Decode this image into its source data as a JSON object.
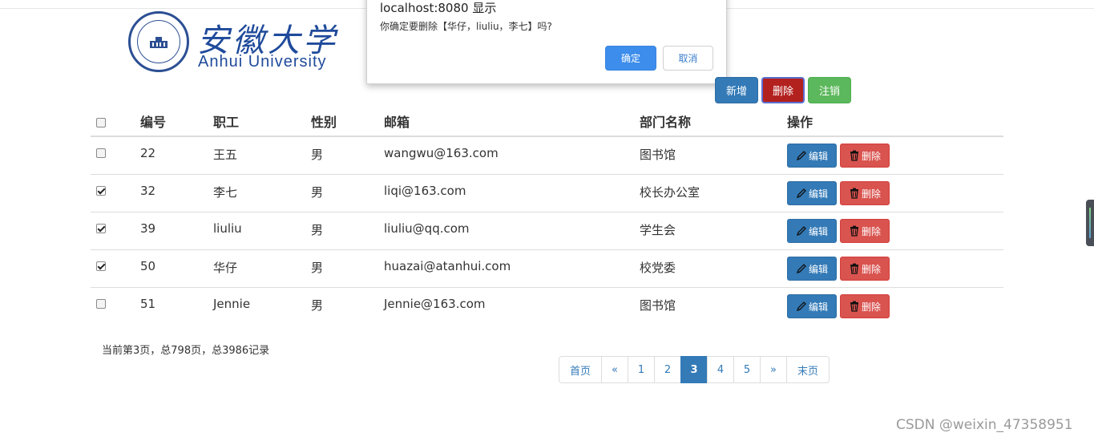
{
  "logo": {
    "cn": "安徽大学",
    "en": "Anhui University"
  },
  "dialog": {
    "title": "localhost:8080 显示",
    "message": "你确定要删除【华仔，liuliu，李七】吗?",
    "ok": "确定",
    "cancel": "取消"
  },
  "toolbar": {
    "add": "新增",
    "delete": "删除",
    "logout": "注销"
  },
  "table": {
    "headers": {
      "id": "编号",
      "name": "职工",
      "gender": "性别",
      "email": "邮箱",
      "dept": "部门名称",
      "op": "操作"
    },
    "edit_label": "编辑",
    "delete_label": "删除",
    "rows": [
      {
        "checked": false,
        "id": "22",
        "name": "王五",
        "gender": "男",
        "email": "wangwu@163.com",
        "dept": "图书馆"
      },
      {
        "checked": true,
        "id": "32",
        "name": "李七",
        "gender": "男",
        "email": "liqi@163.com",
        "dept": "校长办公室"
      },
      {
        "checked": true,
        "id": "39",
        "name": "liuliu",
        "gender": "男",
        "email": "liuliu@qq.com",
        "dept": "学生会"
      },
      {
        "checked": true,
        "id": "50",
        "name": "华仔",
        "gender": "男",
        "email": "huazai@atanhui.com",
        "dept": "校党委"
      },
      {
        "checked": false,
        "id": "51",
        "name": "Jennie",
        "gender": "男",
        "email": "Jennie@163.com",
        "dept": "图书馆"
      }
    ]
  },
  "pagination": {
    "info": "当前第3页，总798页，总3986记录",
    "first": "首页",
    "prev": "«",
    "pages": [
      "1",
      "2",
      "3",
      "4",
      "5"
    ],
    "active_page": "3",
    "next": "»",
    "last": "末页"
  },
  "watermark": "CSDN @weixin_47358951",
  "colors": {
    "primary": "#337ab7",
    "danger": "#d9534f",
    "success": "#5cb85c",
    "dialog_ok": "#3c8dec",
    "logo_blue": "#1f4a9b"
  }
}
